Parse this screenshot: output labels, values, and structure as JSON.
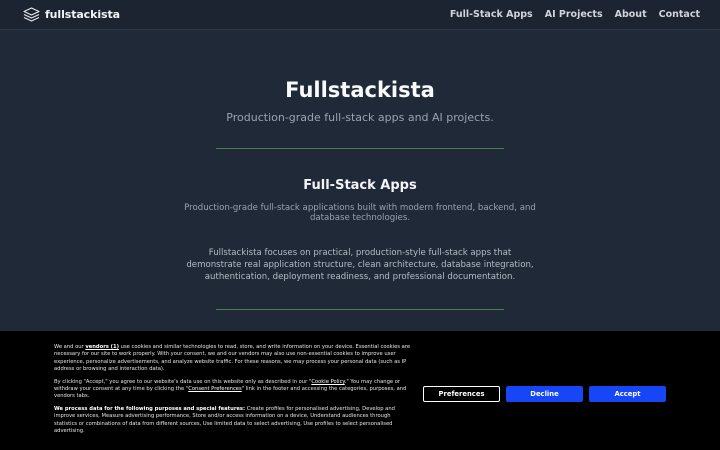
{
  "header": {
    "brand_name": "fullstackista",
    "brand_icon": "layers-icon",
    "nav": [
      "Full-Stack Apps",
      "AI Projects",
      "About",
      "Contact"
    ]
  },
  "hero": {
    "title": "Fullstackista",
    "subtitle": "Production-grade full-stack apps and AI projects."
  },
  "section": {
    "title": "Full-Stack Apps",
    "subtitle": "Production-grade full-stack applications built with modern frontend, backend, and database technologies.",
    "body": "Fullstackista focuses on practical, production-style full-stack apps that demonstrate real application structure, clean architecture, database integration, authentication, deployment readiness, and professional documentation."
  },
  "cookie": {
    "p1_start": "We and our ",
    "vendors_link": "vendors (1)",
    "p1_end": " use cookies and similar technologies to read, store, and write information on your device. Essential cookies are necessary for our site to work properly. With your consent, we and our vendors may also use non-essential cookies to improve user experience, personalize advertisements, and analyze website traffic. For these reasons, we may process your personal data (such as IP address or browsing and interaction data).",
    "p2_start": "By clicking \"Accept,\" you agree to our website's data use on this website only as described in our \"",
    "cookie_policy_link": "Cookie Policy",
    "p2_mid": ".\" You may change or withdraw your consent at any time by clicking the \"",
    "consent_prefs_link": "Consent Preferences",
    "p2_end": "\" link in the footer and accessing the categories, purposes, and vendors tabs.",
    "p3_bold": "We process data for the following purposes and special features:",
    "p3_rest": " Create profiles for personalised advertising, Develop and improve services, Measure advertising performance, Store and/or access information on a device, Understand audiences through statistics or combinations of data from different sources, Use limited data to select advertising, Use profiles to select personalised advertising.",
    "buttons": {
      "preferences": "Preferences",
      "decline": "Decline",
      "accept": "Accept"
    }
  },
  "colors": {
    "background": "#1f2937",
    "divider": "#4d7a58",
    "primary_button": "#1646f5"
  }
}
